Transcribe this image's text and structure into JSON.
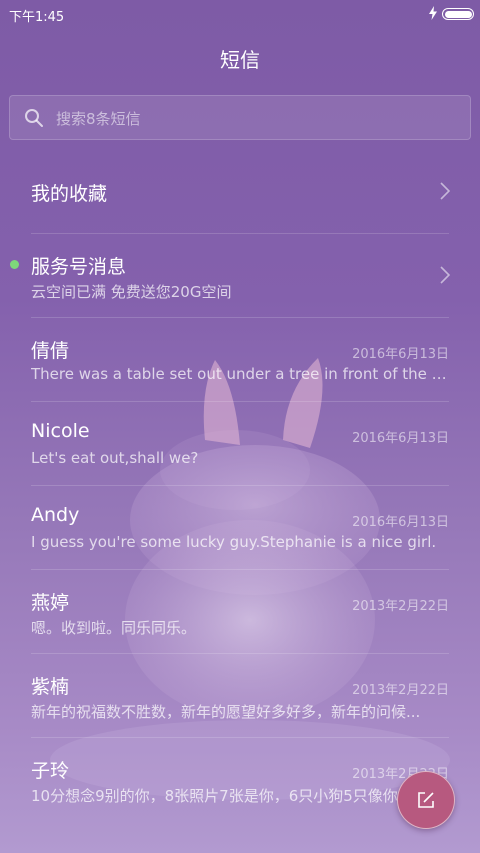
{
  "status_bar": {
    "time": "下午1:45",
    "battery_icon": "battery-icon",
    "charging_icon": "bolt-icon"
  },
  "header": {
    "title": "短信"
  },
  "search": {
    "placeholder": "搜索8条短信",
    "icon": "search-icon"
  },
  "favorites": {
    "label": "我的收藏"
  },
  "service": {
    "title": "服务号消息",
    "subtitle": "云空间已满 免费送您20G空间",
    "unread": true,
    "dot_color": "#7ed87a"
  },
  "conversations": [
    {
      "name": "倩倩",
      "date": "2016年6月13日",
      "preview": "There was a table set out under a tree in front of the ho..."
    },
    {
      "name": "Nicole",
      "date": "2016年6月13日",
      "preview": "Let's eat out,shall we?"
    },
    {
      "name": "Andy",
      "date": "2016年6月13日",
      "preview": "I guess you're some lucky guy.Stephanie is a nice girl."
    },
    {
      "name": "燕婷",
      "date": "2013年2月22日",
      "preview": "嗯。收到啦。同乐同乐。"
    },
    {
      "name": "紫楠",
      "date": "2013年2月22日",
      "preview": "新年的祝福数不胜数，新年的愿望好多好多，新年的问候..."
    },
    {
      "name": "子玲",
      "date": "2013年2月22日",
      "preview": "10分想念9别的你，8张照片7张是你，6只小狗5只像你..."
    }
  ],
  "fab": {
    "icon": "compose-icon",
    "color": "#b7597f"
  }
}
